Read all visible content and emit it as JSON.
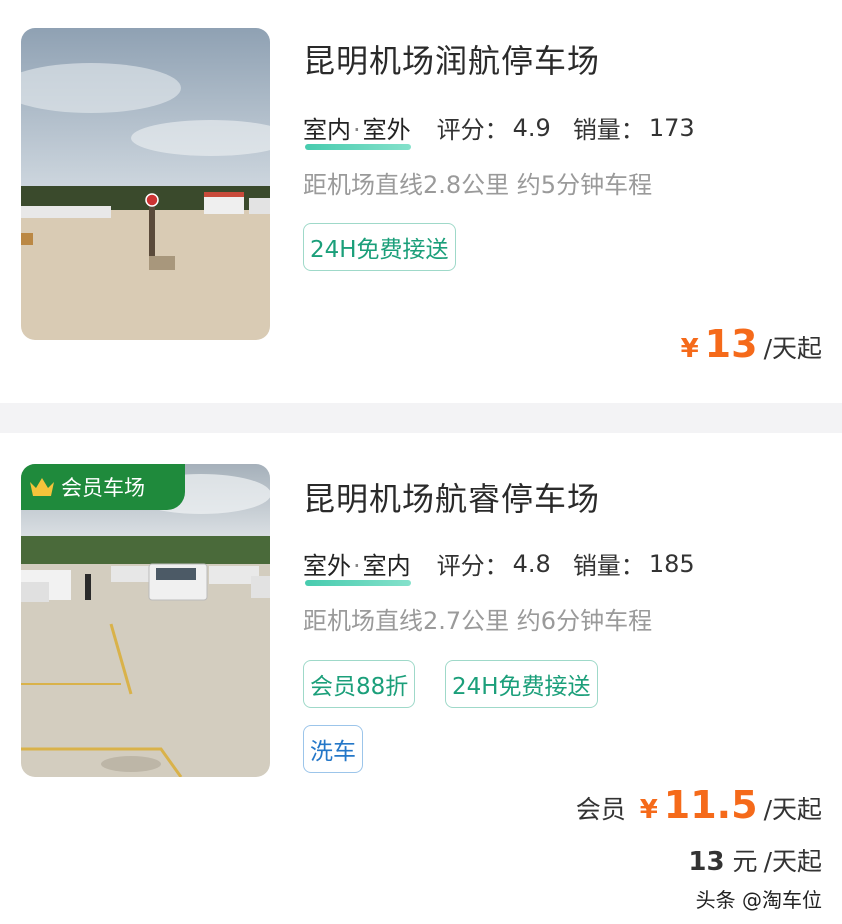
{
  "listings": [
    {
      "name": "昆明机场润航停车场",
      "location": [
        "室内",
        "室外"
      ],
      "score_label": "评分：",
      "score": "4.9",
      "sales_label": "销量：",
      "sales": "173",
      "distance": "距机场直线2.8公里 约5分钟车程",
      "tags": [
        {
          "label": "24H免费接送",
          "color": "green"
        }
      ],
      "price": {
        "currency": "¥",
        "value": "13",
        "unit": "/天起"
      }
    },
    {
      "name": "昆明机场航睿停车场",
      "badge": "会员车场",
      "location": [
        "室外",
        "室内"
      ],
      "score_label": "评分：",
      "score": "4.8",
      "sales_label": "销量：",
      "sales": "185",
      "distance": "距机场直线2.7公里 约6分钟车程",
      "tags": [
        {
          "label": "会员88折",
          "color": "green"
        },
        {
          "label": "24H免费接送",
          "color": "green"
        },
        {
          "label": "洗车",
          "color": "blue"
        }
      ],
      "price": {
        "prefix": "会员",
        "currency": "¥",
        "value": "11.5",
        "unit": "/天起"
      },
      "regular_price": {
        "value": "13",
        "currency": "元",
        "unit": "/天起"
      }
    }
  ],
  "separator": "·",
  "watermark": "头条 @淘车位",
  "colors": {
    "accent_orange": "#f56a1a",
    "tag_green": "#1b9f7a",
    "tag_blue": "#2477c8",
    "badge_green": "#1f8a3c"
  }
}
